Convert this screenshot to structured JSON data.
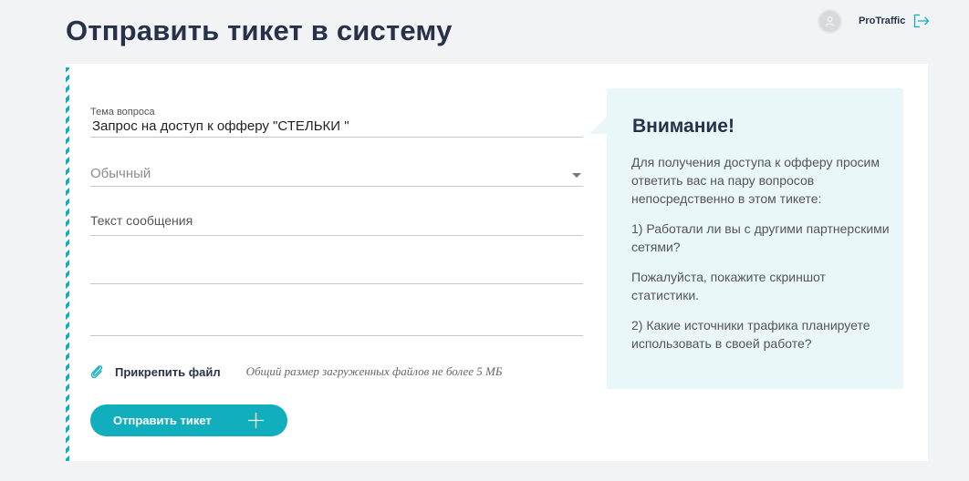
{
  "page": {
    "title": "Отправить тикет в систему"
  },
  "user": {
    "name": "ProTraffic"
  },
  "form": {
    "subject_label": "Тема вопроса",
    "subject_value": "Запрос на доступ к офферу \"СТЕЛЬКИ \"",
    "priority_value": "Обычный",
    "message_placeholder": "Текст сообщения",
    "attach_label": "Прикрепить файл",
    "attach_hint": "Общий размер загруженных файлов не более 5 МБ",
    "submit_label": "Отправить тикет"
  },
  "notice": {
    "title": "Внимание!",
    "paragraphs": [
      "Для получения доступа к офферу просим ответить вас на пару вопросов непосредственно в этом тикете:",
      "1) Работали ли вы с другими партнерскими сетями?",
      "Пожалуйста, покажите скриншот статистики.",
      "2) Какие источники трафика планируете использовать в своей работе?"
    ]
  },
  "colors": {
    "accent": "#11aebd",
    "title": "#27324a",
    "notice_bg": "#e9f7f8"
  },
  "icons": [
    "user-icon",
    "logout-icon",
    "chevron-down-icon",
    "paperclip-icon",
    "plus-icon"
  ]
}
